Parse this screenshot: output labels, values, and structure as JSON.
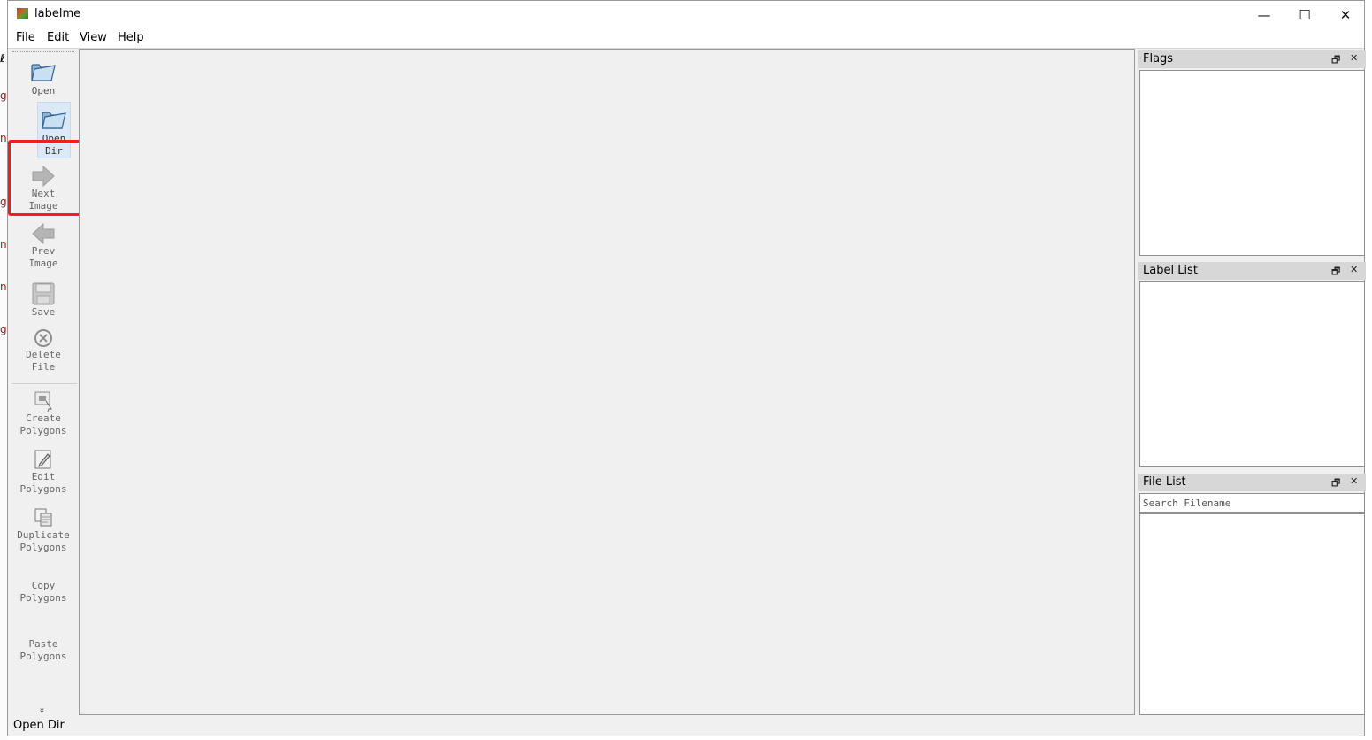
{
  "window": {
    "title": "labelme",
    "controls": {
      "minimize": "—",
      "maximize": "☐",
      "close": "✕"
    }
  },
  "menu": {
    "items": [
      "File",
      "Edit",
      "View",
      "Help"
    ]
  },
  "toolbar": {
    "open": "Open",
    "open_dir": "Open\nDir",
    "next_image": "Next\nImage",
    "prev_image": "Prev\nImage",
    "save": "Save",
    "delete_file": "Delete\nFile",
    "create_polygons": "Create\nPolygons",
    "edit_polygons": "Edit\nPolygons",
    "duplicate_polygons": "Duplicate\nPolygons",
    "copy_polygons": "Copy\nPolygons",
    "paste_polygons": "Paste\nPolygons",
    "more": "»"
  },
  "docks": {
    "flags": {
      "title": "Flags"
    },
    "label_list": {
      "title": "Label List"
    },
    "file_list": {
      "title": "File List",
      "search_placeholder": "Search Filename"
    },
    "float_icon": "🗗",
    "close_icon": "✕"
  },
  "status": {
    "text": "Open Dir"
  },
  "background_fragments": [
    "ℓ",
    "g",
    "n",
    "g",
    "n",
    "n",
    "g"
  ],
  "colors": {
    "highlight": "#f01e1e",
    "selected_tool": "#dbe9f6"
  }
}
